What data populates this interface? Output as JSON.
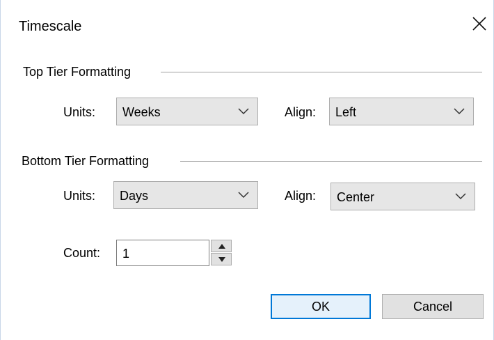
{
  "dialog": {
    "title": "Timescale",
    "close_icon": "close-icon"
  },
  "top_tier": {
    "header": "Top Tier Formatting",
    "units_label": "Units:",
    "units_value": "Weeks",
    "align_label": "Align:",
    "align_value": "Left"
  },
  "bottom_tier": {
    "header": "Bottom Tier Formatting",
    "units_label": "Units:",
    "units_value": "Days",
    "align_label": "Align:",
    "align_value": "Center",
    "count_label": "Count:",
    "count_value": "1"
  },
  "buttons": {
    "ok": "OK",
    "cancel": "Cancel"
  },
  "colors": {
    "accent": "#0078d7",
    "select_bg": "#e6e6e6",
    "button_bg": "#e1e1e1"
  }
}
